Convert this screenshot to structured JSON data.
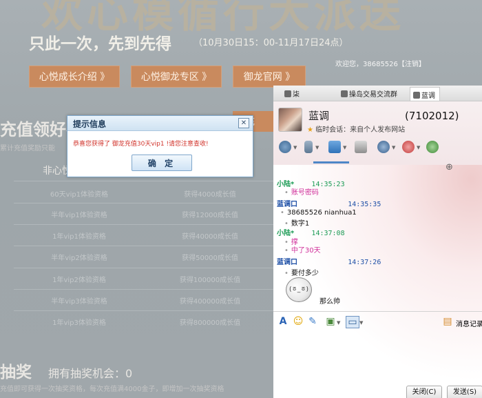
{
  "promo": {
    "big_title": "欢心模循行大派送",
    "slogan": "只此一次，先到先得",
    "date_range": "（10月30日15：00-11月17日24点）",
    "welcome": "欢迎您，38685526【注销】",
    "buttons": [
      "心悦成长介绍 》",
      "心悦御龙专区 》",
      "御龙官网 》"
    ],
    "faint_button": "去充",
    "section_title": "充值领好礼",
    "section_sub": "累计充值奖励只能",
    "col_head": "非心悦",
    "rows": [
      {
        "c1": "60天vip1体验资格",
        "c2": "获得4000成长值"
      },
      {
        "c1": "半年vip1体验资格",
        "c2": "获得12000成长值"
      },
      {
        "c1": "1年vip1体验资格",
        "c2": "获得40000成长值"
      },
      {
        "c1": "半年vip2体验资格",
        "c2": "获得50000成长值"
      },
      {
        "c1": "1年vip2体验资格",
        "c2": "获得100000成长值"
      },
      {
        "c1": "半年vip3体验资格",
        "c2": "获得400000成长值"
      },
      {
        "c1": "1年vip3体验资格",
        "c2": "获得800000成长值"
      }
    ],
    "lottery_title": "抽奖",
    "lottery_sub": "拥有抽奖机会：0",
    "lottery_note": "充值即可获得一次抽奖资格，每次充值满4000金子，即增加一次抽奖资格"
  },
  "dialog": {
    "title": "提示信息",
    "close": "✕",
    "message": "恭喜您获得了 御龙充值30天vip1 !请您注意查收!",
    "ok": "确 定"
  },
  "qq": {
    "tabs": [
      "柒",
      "操岛交易交流群",
      "蓝调"
    ],
    "contact_name": "蓝调",
    "contact_id": "(7102012)",
    "status": "临时会话：来自个人发布网站",
    "messages": [
      {
        "sender": "小陆*",
        "time": "14:35:23",
        "lines": [
          "账号密码"
        ],
        "style": "g",
        "pink": true
      },
      {
        "sender": "蓝调口",
        "time": "14:35:35",
        "lines": [
          "38685526  nianhua1",
          "数字1"
        ],
        "style": "b",
        "pink": false
      },
      {
        "sender": "小陆*",
        "time": "14:37:08",
        "lines": [
          "撑",
          "中了30天"
        ],
        "style": "g",
        "pink": true
      },
      {
        "sender": "蓝调口",
        "time": "14:37:26",
        "lines": [
          "要付多少",
          "那么帅"
        ],
        "style": "b",
        "pink": false
      }
    ],
    "msg_record": "消息记录",
    "close_btn": "关闭(C)",
    "send_btn": "发送(S)"
  }
}
